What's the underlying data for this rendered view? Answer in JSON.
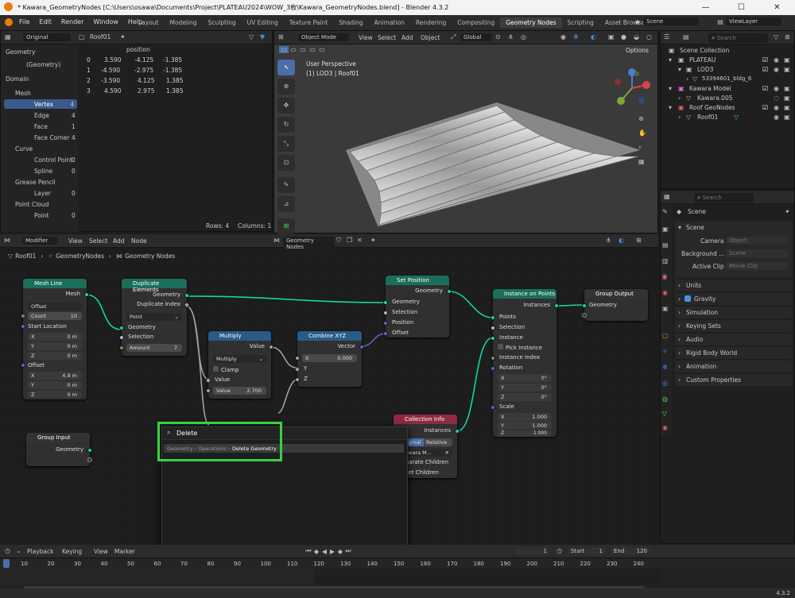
{
  "window": {
    "title": "* Kawara_GeometryNodes [C:\\Users\\osawa\\Documents\\Project\\PLATEAU2024\\WOW_3枚\\Kawara_GeometryNodes.blend] - Blender 4.3.2",
    "min": "—",
    "max": "☐",
    "close": "✕"
  },
  "menu": [
    "File",
    "Edit",
    "Render",
    "Window",
    "Help"
  ],
  "workspaces": [
    "Layout",
    "Modeling",
    "Sculpting",
    "UV Editing",
    "Texture Paint",
    "Shading",
    "Animation",
    "Rendering",
    "Compositing",
    "Geometry Nodes",
    "Scripting",
    "Asset Browser"
  ],
  "workspace_add": "+",
  "scene": {
    "name": "Scene",
    "view_layer": "ViewLayer"
  },
  "spreadsheet": {
    "mode": "Original",
    "object": "Roof01",
    "tree": [
      {
        "label": "Geometry",
        "count": ""
      },
      {
        "label": "(Geometry)",
        "count": ""
      },
      {
        "label": "Domain",
        "count": ""
      },
      {
        "label": "Mesh",
        "count": ""
      },
      {
        "label": "Vertex",
        "count": "4"
      },
      {
        "label": "Edge",
        "count": "4"
      },
      {
        "label": "Face",
        "count": "1"
      },
      {
        "label": "Face Corner",
        "count": "4"
      },
      {
        "label": "Curve",
        "count": ""
      },
      {
        "label": "Control Point",
        "count": "0"
      },
      {
        "label": "Spline",
        "count": "0"
      },
      {
        "label": "Grease Pencil",
        "count": ""
      },
      {
        "label": "Layer",
        "count": "0"
      },
      {
        "label": "Point Cloud",
        "count": ""
      },
      {
        "label": "Point",
        "count": "0"
      }
    ],
    "column": "position",
    "rows": [
      {
        "i": "0",
        "x": "3.590",
        "y": "-4.125",
        "z": "-1.385"
      },
      {
        "i": "1",
        "x": "-4.590",
        "y": "-2.975",
        "z": "-1.385"
      },
      {
        "i": "2",
        "x": "-3.590",
        "y": "4.125",
        "z": "1.385"
      },
      {
        "i": "3",
        "x": "4.590",
        "y": "2.975",
        "z": "1.385"
      }
    ],
    "rows_label": "Rows: 4",
    "cols_label": "Columns: 1"
  },
  "viewport": {
    "mode": "Object Mode",
    "menus": [
      "View",
      "Select",
      "Add",
      "Object"
    ],
    "orientation": "Global",
    "perspective": "User Perspective",
    "collection": "(1) LOD3 | Roof01",
    "options": "Options"
  },
  "outliner": {
    "search_placeholder": "Search",
    "rows": [
      {
        "label": "Scene Collection",
        "color": "#cfcfcf"
      },
      {
        "label": "PLATEAU",
        "color": "#dcdcdc"
      },
      {
        "label": "LOD3",
        "color": "#dcdcdc"
      },
      {
        "label": "53394601_bldg_6",
        "color": "#8a8a8a"
      },
      {
        "label": "Kawara Model",
        "color": "#dcdcdc"
      },
      {
        "label": "Kawara.005",
        "color": "#8a8a8a"
      },
      {
        "label": "Roof GeoNodes",
        "color": "#dcdcdc"
      },
      {
        "label": "Roof01",
        "color": "#dcdcdc"
      }
    ]
  },
  "properties": {
    "search_placeholder": "Search",
    "breadcrumb": "Scene",
    "scene_label": "Scene",
    "camera_label": "Camera",
    "camera_value": "Object",
    "bg_label": "Background ...",
    "bg_value": "Scene",
    "clip_label": "Active Clip",
    "clip_value": "Movie Clip",
    "sections": [
      "Units",
      "Gravity",
      "Simulation",
      "Keying Sets",
      "Audio",
      "Rigid Body World",
      "Animation",
      "Custom Properties"
    ]
  },
  "node_editor": {
    "menus": [
      "Modifier",
      "View",
      "Select",
      "Add",
      "Node"
    ],
    "tree_name": "Geometry Nodes",
    "breadcrumb": [
      "Roof01",
      "GeometryNodes",
      "Geometry Nodes"
    ],
    "nodes": {
      "mesh_line": {
        "title": "Mesh Line",
        "mesh": "Mesh",
        "mode": "Offset",
        "count_label": "Count",
        "count": "10",
        "start": "Start Location",
        "x": "X",
        "y": "Y",
        "z": "Z",
        "sx": "0 m",
        "sy": "0 m",
        "sz": "0 m",
        "offset": "Offset",
        "ox": "4.9 m",
        "oy": "0 m",
        "oz": "0 m"
      },
      "dup": {
        "title": "Duplicate Elements",
        "geometry": "Geometry",
        "dup_index": "Duplicate Index",
        "domain": "Point",
        "selection": "Selection",
        "amount_label": "Amount",
        "amount": "7"
      },
      "multiply": {
        "title": "Multiply",
        "value": "Value",
        "op": "Multiply",
        "clamp": "Clamp",
        "in_value": "Value",
        "value_label": "Value",
        "value_num": "2.700"
      },
      "combine": {
        "title": "Combine XYZ",
        "vector": "Vector",
        "x": "X",
        "x_val": "0.000",
        "y": "Y",
        "z": "Z"
      },
      "setpos": {
        "title": "Set Position",
        "geometry": "Geometry",
        "selection": "Selection",
        "position": "Position",
        "offset": "Offset"
      },
      "iop": {
        "title": "Instance on Points",
        "instances": "Instances",
        "points": "Points",
        "selection": "Selection",
        "instance": "Instance",
        "pick": "Pick Instance",
        "idx": "Instance Index",
        "rotation": "Rotation",
        "rx": "0°",
        "ry": "0°",
        "rz": "0°",
        "scale": "Scale",
        "sx": "1.000",
        "sy": "1.000",
        "sz": "1.000",
        "x": "X",
        "y": "Y",
        "z": "Z"
      },
      "gout": {
        "title": "Group Output",
        "geometry": "Geometry"
      },
      "gin": {
        "title": "Group Input",
        "geometry": "Geometry"
      },
      "coll": {
        "title": "Collection Info",
        "instances": "Instances",
        "original": "Original",
        "relative": "Relative",
        "collection": "Kawara M...",
        "sep": "Separate Children",
        "reset": "Reset Children"
      }
    },
    "search": {
      "query": "Delete",
      "result_path": "Geometry › Operations ›",
      "result": "Delete Geometry"
    }
  },
  "timeline": {
    "menus": [
      "Playback",
      "Keying",
      "View",
      "Marker"
    ],
    "current": "1",
    "start_label": "Start",
    "start": "1",
    "end_label": "End",
    "end": "120",
    "ticks": [
      "10",
      "20",
      "30",
      "40",
      "50",
      "60",
      "70",
      "80",
      "90",
      "100",
      "110",
      "120",
      "130",
      "140",
      "150",
      "160",
      "170",
      "180",
      "190",
      "200",
      "210",
      "220",
      "230",
      "240"
    ]
  },
  "status": {
    "version": "4.3.2"
  },
  "colors": {
    "highlight": "#38d33f",
    "geo_header": "#1b6e5a",
    "conv_header": "#2a5a87",
    "input_header": "#8f2a43"
  }
}
